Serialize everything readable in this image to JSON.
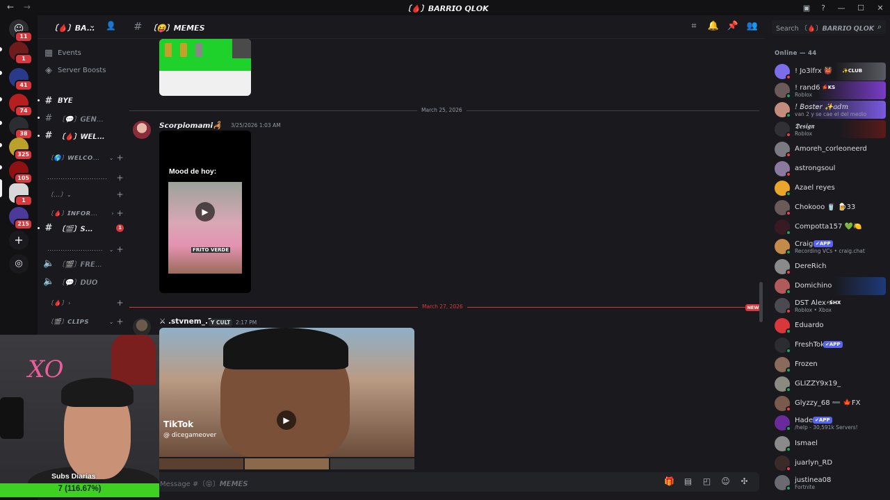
{
  "titlebar": {
    "title": "〔🩸〕𝘽𝘼𝙍𝙍𝙄𝙊 𝙌𝙇𝙊𝙆",
    "back": "←",
    "forward": "→"
  },
  "servers": [
    {
      "badge": "11",
      "color": "#2b2d31"
    },
    {
      "badge": "1",
      "color": "#6e1b1b"
    },
    {
      "badge": "41",
      "color": "#2a3a8a"
    },
    {
      "badge": "74",
      "color": "#b51f1f"
    },
    {
      "badge": "38",
      "color": "#2b2d31"
    },
    {
      "badge": "325",
      "color": "#b9a12a"
    },
    {
      "badge": "105",
      "color": "#8f1111"
    },
    {
      "badge": "1",
      "color": "#d8d8d8"
    },
    {
      "badge": "215",
      "color": "#4a3a9a"
    }
  ],
  "guild": {
    "name": "〔🩸〕𝘽𝘼...",
    "chevron": "⌄"
  },
  "channels": {
    "events": "Events",
    "boosts": "Server Boosts",
    "bye": "𝘽𝙔𝙀",
    "gen": "〔💬〕𝙂𝙀𝙉...",
    "wel": "〔🩸〕𝙒𝙀𝙇...",
    "welcome_cat": "〔🌎〕𝙒𝙀𝙇𝘾𝙊...",
    "dots1": "...........................",
    "brackets": "〔...〕",
    "info_cat": "〔🩸〕𝙄𝙉𝙁𝙊𝙍...",
    "s_ch": "〔🎬〕𝙎...",
    "s_badge": "1",
    "dots2": ".........................",
    "fre": "〔🎬〕𝙁𝙍𝙀...",
    "duo": "〔💬〕𝘿𝙐𝙊",
    "blood_cat": "〔🩸〕",
    "clips_cat": "〔🎬〕𝘾𝙇𝙄𝙋𝙎"
  },
  "chat_header": {
    "channel": "〔😝〕𝙈𝙀𝙈𝙀𝙎"
  },
  "search": {
    "placeholder": "Search 〔🩸〕𝘽𝘼𝙍𝙍𝙄𝙊 𝙌𝙇𝙊𝙆"
  },
  "messages": {
    "date1": "March 25, 2026",
    "m1_author": "𝙎𝙘𝙤𝙧𝙥𝙞𝙤𝙢𝙖𝙢𝙞🦂",
    "m1_time": "3/25/2026 1:03 AM",
    "m1_caption": "Mood de hoy:",
    "m1_frito": "FRITO VERDE",
    "date2": "March 27, 2026",
    "new_label": "NEW",
    "m2_author": "⚔ .stvnem_.?",
    "m2_tag": "Y CULT",
    "m2_time": "2:17 PM",
    "m2_tiktok": "TikTok",
    "m2_handle": "@ dicegameover"
  },
  "composer": {
    "placeholder": "Message #〔😝〕𝙈𝙀𝙈𝙀𝙎"
  },
  "members": {
    "header": "Online — 44",
    "list": [
      {
        "name": "! Jo3lfrx 👹",
        "sub": "",
        "badge": "✨CLUB",
        "color": "#7b6ee8"
      },
      {
        "name": "! rand6 ⚡",
        "sub": "Roblox",
        "badge": "🍁KS",
        "color": "#6b5a58"
      },
      {
        "name": "! 𝘉𝘰𝘴𝘵𝘦𝘳 ✨adm",
        "sub": "van 2 y se cae el del medio",
        "badge": "",
        "color": "#c48c7c"
      },
      {
        "name": "𝕯𝖊𝖘𝖎𝖌𝖓",
        "sub": "Roblox",
        "badge": "",
        "color": "#303035"
      },
      {
        "name": "Amoreh_corleoneerd",
        "sub": "",
        "badge": "",
        "color": "#7a7a80"
      },
      {
        "name": "astrongsoul",
        "sub": "",
        "badge": "",
        "color": "#8a7aa0"
      },
      {
        "name": "Azael reyes",
        "sub": "",
        "badge": "",
        "color": "#e8a62a"
      },
      {
        "name": "Chokooo 🥤 🍺33",
        "sub": "",
        "badge": "",
        "color": "#6a5a5a"
      },
      {
        "name": "Compotta157 💚🍋",
        "sub": "",
        "badge": "",
        "color": "#3a1a22"
      },
      {
        "name": "Craig",
        "sub": "Recording VCs • craig.chat",
        "badge": "✔APP",
        "color": "#c48a4a"
      },
      {
        "name": "DereRich",
        "sub": "",
        "badge": "",
        "color": "#8a8a8a"
      },
      {
        "name": "Domichino",
        "sub": "",
        "badge": "",
        "color": "#b05a5a"
      },
      {
        "name": "DST Alex ⚡",
        "sub": "Roblox • Xbox",
        "badge": "⚡SHX",
        "color": "#4a4a50"
      },
      {
        "name": "Eduardo",
        "sub": "",
        "badge": "",
        "color": "#da373c"
      },
      {
        "name": "FreshTok",
        "sub": "",
        "badge": "✔APP",
        "color": "#2b2d31"
      },
      {
        "name": "Frozen",
        "sub": "",
        "badge": "",
        "color": "#8a6a5a"
      },
      {
        "name": "GLIZZY9x19_",
        "sub": "",
        "badge": "",
        "color": "#8a8a80"
      },
      {
        "name": "Glyzzy_68 ➖ 🍁FX",
        "sub": "",
        "badge": "",
        "color": "#7a5a4a"
      },
      {
        "name": "Hade",
        "sub": "/help - 30,591k Servers!",
        "badge": "✔APP",
        "color": "#6a2a9a"
      },
      {
        "name": "Ismael",
        "sub": "",
        "badge": "",
        "color": "#8a8a8a"
      },
      {
        "name": "juarlyn_RD",
        "sub": "",
        "badge": "",
        "color": "#3a2a2a"
      },
      {
        "name": "justinea08",
        "sub": "Fortnite",
        "badge": "",
        "color": "#6a6a70"
      }
    ]
  },
  "webcam": {
    "label": "Subs Diarias"
  },
  "goal": {
    "text": "7 (116.67%)",
    "progress": 1.1667
  }
}
